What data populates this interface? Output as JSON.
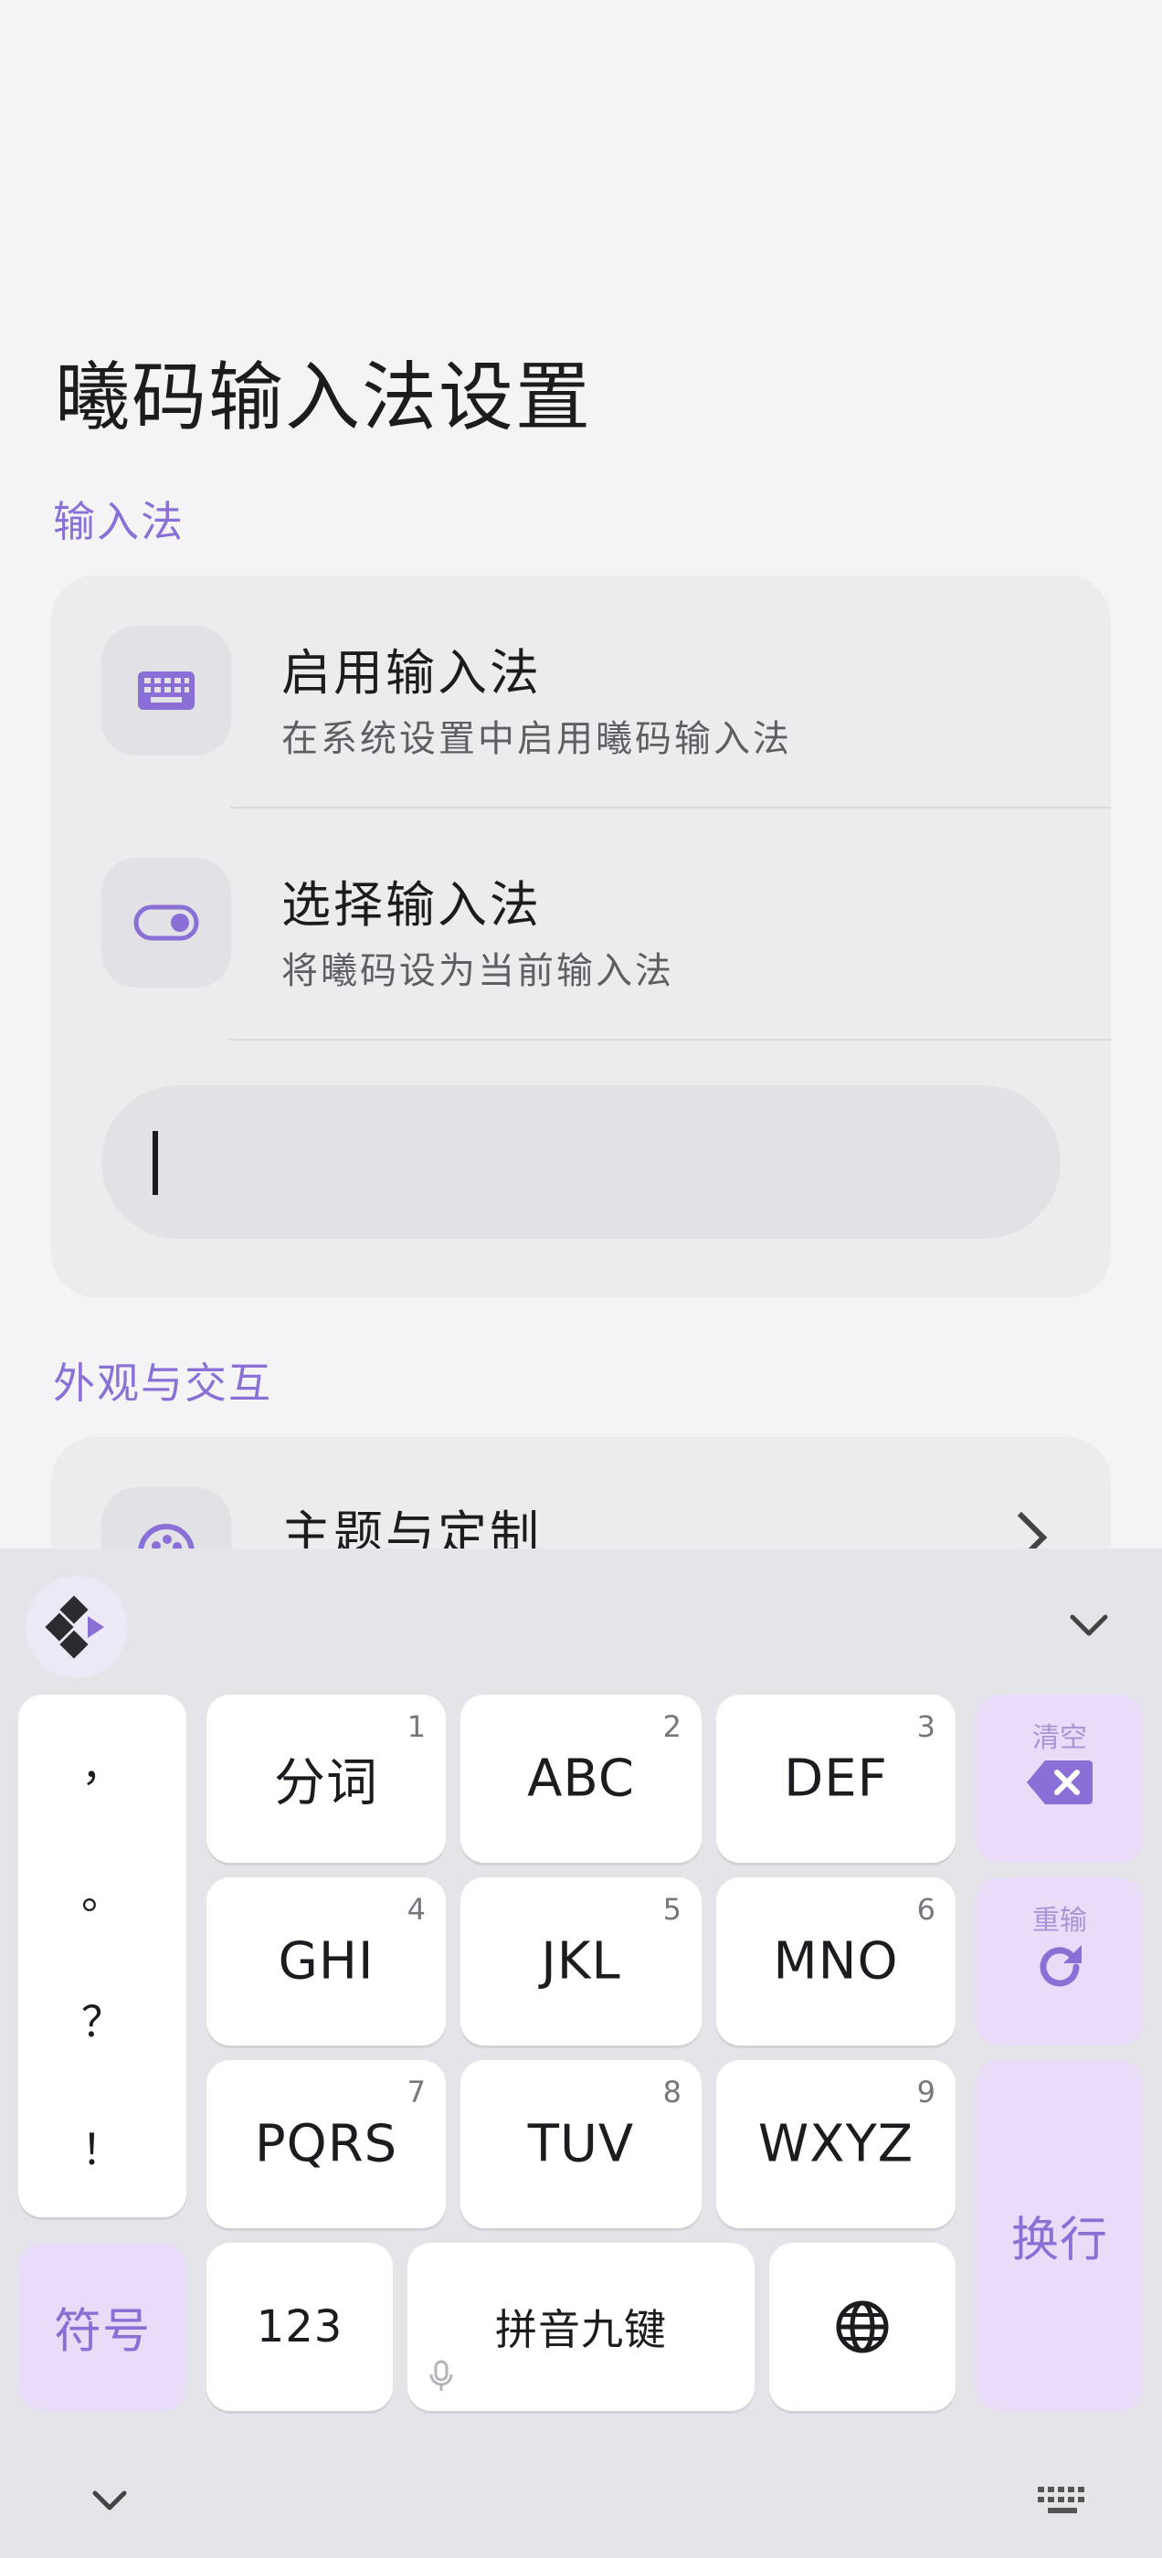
{
  "page": {
    "title": "曦码输入法设置",
    "sections": {
      "input_method": {
        "header": "输入法",
        "items": [
          {
            "title": "启用输入法",
            "subtitle": "在系统设置中启用曦码输入法",
            "icon": "keyboard-icon"
          },
          {
            "title": "选择输入法",
            "subtitle": "将曦码设为当前输入法",
            "icon": "toggle-icon"
          }
        ],
        "test_field": {
          "value": "",
          "placeholder": ""
        }
      },
      "appearance": {
        "header": "外观与交互",
        "items": [
          {
            "title": "主题与定制",
            "icon": "palette-icon"
          }
        ]
      }
    }
  },
  "keyboard": {
    "toolbar": {
      "logo_icon": "ximа-logo-icon",
      "collapse_icon": "chevron-down-icon"
    },
    "punctuation": [
      "，",
      "。",
      "？",
      "！"
    ],
    "keys": [
      {
        "label": "分词",
        "num": "1"
      },
      {
        "label": "ABC",
        "num": "2"
      },
      {
        "label": "DEF",
        "num": "3"
      },
      {
        "label": "GHI",
        "num": "4"
      },
      {
        "label": "JKL",
        "num": "5"
      },
      {
        "label": "MNO",
        "num": "6"
      },
      {
        "label": "PQRS",
        "num": "7"
      },
      {
        "label": "TUV",
        "num": "8"
      },
      {
        "label": "WXYZ",
        "num": "9"
      }
    ],
    "clear": {
      "hint": "清空",
      "icon": "backspace-icon"
    },
    "reenter": {
      "hint": "重输",
      "icon": "refresh-icon"
    },
    "enter_label": "换行",
    "symbols_label": "符号",
    "numbers_label": "123",
    "space_label": "拼音九键",
    "space_icon": "microphone-icon",
    "language_icon": "globe-icon",
    "nav": {
      "left_icon": "chevron-down-icon",
      "right_icon": "keyboard-icon"
    },
    "colors": {
      "accent": "#8a6fd6",
      "func_key": "#e8dcf8",
      "keyboard_bg": "#e4e4e9"
    }
  }
}
